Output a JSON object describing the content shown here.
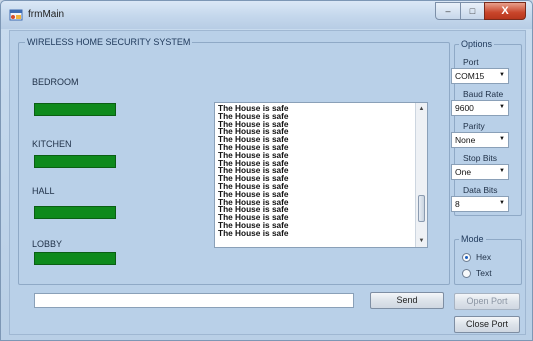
{
  "window": {
    "title": "frmMain",
    "buttons": {
      "minimize": "–",
      "maximize": "□",
      "close": "X"
    }
  },
  "security_panel": {
    "title": "WIRELESS HOME SECURITY SYSTEM",
    "rooms": [
      {
        "label": "BEDROOM",
        "status_color": "#0e8a1c"
      },
      {
        "label": "KITCHEN",
        "status_color": "#0e8a1c"
      },
      {
        "label": "HALL",
        "status_color": "#0e8a1c"
      },
      {
        "label": "LOBBY",
        "status_color": "#0e8a1c"
      }
    ]
  },
  "log": {
    "lines": [
      "The House is safe",
      "The House is safe",
      "The House is safe",
      "The House is safe",
      "The House is safe",
      "The House is safe",
      "The House is safe",
      "The House is safe",
      "The House is safe",
      "The House is safe",
      "The House is safe",
      "The House is safe",
      "The House is safe",
      "The House is safe",
      "The House is safe",
      "The House is safe",
      "The House is safe"
    ]
  },
  "send": {
    "input_value": "",
    "button_label": "Send"
  },
  "options": {
    "title": "Options",
    "port": {
      "label": "Port",
      "value": "COM15"
    },
    "baud_rate": {
      "label": "Baud Rate",
      "value": "9600"
    },
    "parity": {
      "label": "Parity",
      "value": "None"
    },
    "stop_bits": {
      "label": "Stop Bits",
      "value": "One"
    },
    "data_bits": {
      "label": "Data Bits",
      "value": "8"
    }
  },
  "mode": {
    "title": "Mode",
    "options": [
      {
        "label": "Hex",
        "checked": true
      },
      {
        "label": "Text",
        "checked": false
      }
    ]
  },
  "port_buttons": {
    "open": "Open Port",
    "close": "Close Port"
  },
  "colors": {
    "status_green": "#0e8a1c",
    "titlebar": "#c4d7ec",
    "client": "#b9d0e8"
  },
  "icons": {
    "app": "app-window-icon",
    "dropdown": "chevron-down-icon"
  }
}
